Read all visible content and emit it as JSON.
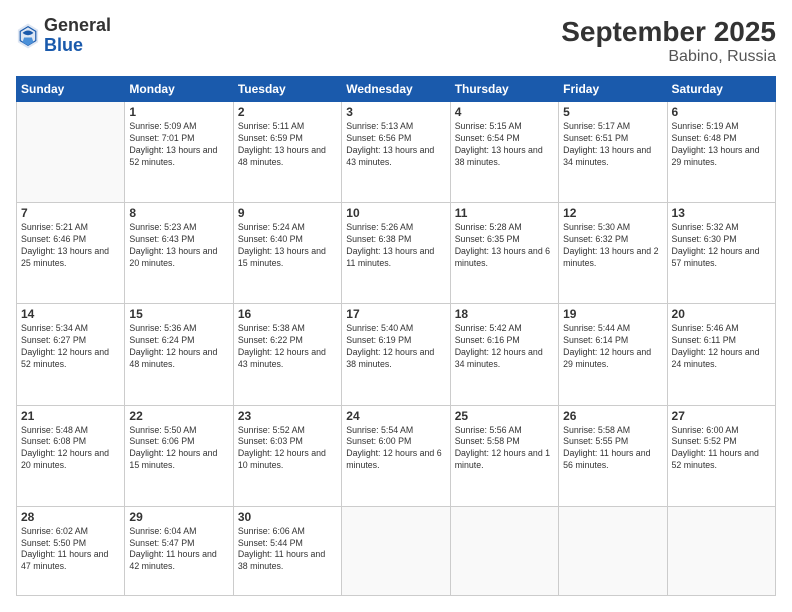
{
  "logo": {
    "general": "General",
    "blue": "Blue"
  },
  "title": {
    "month": "September 2025",
    "location": "Babino, Russia"
  },
  "weekdays": [
    "Sunday",
    "Monday",
    "Tuesday",
    "Wednesday",
    "Thursday",
    "Friday",
    "Saturday"
  ],
  "weeks": [
    [
      {
        "day": "",
        "empty": true
      },
      {
        "day": "1",
        "sunrise": "Sunrise: 5:09 AM",
        "sunset": "Sunset: 7:01 PM",
        "daylight": "Daylight: 13 hours and 52 minutes."
      },
      {
        "day": "2",
        "sunrise": "Sunrise: 5:11 AM",
        "sunset": "Sunset: 6:59 PM",
        "daylight": "Daylight: 13 hours and 48 minutes."
      },
      {
        "day": "3",
        "sunrise": "Sunrise: 5:13 AM",
        "sunset": "Sunset: 6:56 PM",
        "daylight": "Daylight: 13 hours and 43 minutes."
      },
      {
        "day": "4",
        "sunrise": "Sunrise: 5:15 AM",
        "sunset": "Sunset: 6:54 PM",
        "daylight": "Daylight: 13 hours and 38 minutes."
      },
      {
        "day": "5",
        "sunrise": "Sunrise: 5:17 AM",
        "sunset": "Sunset: 6:51 PM",
        "daylight": "Daylight: 13 hours and 34 minutes."
      },
      {
        "day": "6",
        "sunrise": "Sunrise: 5:19 AM",
        "sunset": "Sunset: 6:48 PM",
        "daylight": "Daylight: 13 hours and 29 minutes."
      }
    ],
    [
      {
        "day": "7",
        "sunrise": "Sunrise: 5:21 AM",
        "sunset": "Sunset: 6:46 PM",
        "daylight": "Daylight: 13 hours and 25 minutes."
      },
      {
        "day": "8",
        "sunrise": "Sunrise: 5:23 AM",
        "sunset": "Sunset: 6:43 PM",
        "daylight": "Daylight: 13 hours and 20 minutes."
      },
      {
        "day": "9",
        "sunrise": "Sunrise: 5:24 AM",
        "sunset": "Sunset: 6:40 PM",
        "daylight": "Daylight: 13 hours and 15 minutes."
      },
      {
        "day": "10",
        "sunrise": "Sunrise: 5:26 AM",
        "sunset": "Sunset: 6:38 PM",
        "daylight": "Daylight: 13 hours and 11 minutes."
      },
      {
        "day": "11",
        "sunrise": "Sunrise: 5:28 AM",
        "sunset": "Sunset: 6:35 PM",
        "daylight": "Daylight: 13 hours and 6 minutes."
      },
      {
        "day": "12",
        "sunrise": "Sunrise: 5:30 AM",
        "sunset": "Sunset: 6:32 PM",
        "daylight": "Daylight: 13 hours and 2 minutes."
      },
      {
        "day": "13",
        "sunrise": "Sunrise: 5:32 AM",
        "sunset": "Sunset: 6:30 PM",
        "daylight": "Daylight: 12 hours and 57 minutes."
      }
    ],
    [
      {
        "day": "14",
        "sunrise": "Sunrise: 5:34 AM",
        "sunset": "Sunset: 6:27 PM",
        "daylight": "Daylight: 12 hours and 52 minutes."
      },
      {
        "day": "15",
        "sunrise": "Sunrise: 5:36 AM",
        "sunset": "Sunset: 6:24 PM",
        "daylight": "Daylight: 12 hours and 48 minutes."
      },
      {
        "day": "16",
        "sunrise": "Sunrise: 5:38 AM",
        "sunset": "Sunset: 6:22 PM",
        "daylight": "Daylight: 12 hours and 43 minutes."
      },
      {
        "day": "17",
        "sunrise": "Sunrise: 5:40 AM",
        "sunset": "Sunset: 6:19 PM",
        "daylight": "Daylight: 12 hours and 38 minutes."
      },
      {
        "day": "18",
        "sunrise": "Sunrise: 5:42 AM",
        "sunset": "Sunset: 6:16 PM",
        "daylight": "Daylight: 12 hours and 34 minutes."
      },
      {
        "day": "19",
        "sunrise": "Sunrise: 5:44 AM",
        "sunset": "Sunset: 6:14 PM",
        "daylight": "Daylight: 12 hours and 29 minutes."
      },
      {
        "day": "20",
        "sunrise": "Sunrise: 5:46 AM",
        "sunset": "Sunset: 6:11 PM",
        "daylight": "Daylight: 12 hours and 24 minutes."
      }
    ],
    [
      {
        "day": "21",
        "sunrise": "Sunrise: 5:48 AM",
        "sunset": "Sunset: 6:08 PM",
        "daylight": "Daylight: 12 hours and 20 minutes."
      },
      {
        "day": "22",
        "sunrise": "Sunrise: 5:50 AM",
        "sunset": "Sunset: 6:06 PM",
        "daylight": "Daylight: 12 hours and 15 minutes."
      },
      {
        "day": "23",
        "sunrise": "Sunrise: 5:52 AM",
        "sunset": "Sunset: 6:03 PM",
        "daylight": "Daylight: 12 hours and 10 minutes."
      },
      {
        "day": "24",
        "sunrise": "Sunrise: 5:54 AM",
        "sunset": "Sunset: 6:00 PM",
        "daylight": "Daylight: 12 hours and 6 minutes."
      },
      {
        "day": "25",
        "sunrise": "Sunrise: 5:56 AM",
        "sunset": "Sunset: 5:58 PM",
        "daylight": "Daylight: 12 hours and 1 minute."
      },
      {
        "day": "26",
        "sunrise": "Sunrise: 5:58 AM",
        "sunset": "Sunset: 5:55 PM",
        "daylight": "Daylight: 11 hours and 56 minutes."
      },
      {
        "day": "27",
        "sunrise": "Sunrise: 6:00 AM",
        "sunset": "Sunset: 5:52 PM",
        "daylight": "Daylight: 11 hours and 52 minutes."
      }
    ],
    [
      {
        "day": "28",
        "sunrise": "Sunrise: 6:02 AM",
        "sunset": "Sunset: 5:50 PM",
        "daylight": "Daylight: 11 hours and 47 minutes."
      },
      {
        "day": "29",
        "sunrise": "Sunrise: 6:04 AM",
        "sunset": "Sunset: 5:47 PM",
        "daylight": "Daylight: 11 hours and 42 minutes."
      },
      {
        "day": "30",
        "sunrise": "Sunrise: 6:06 AM",
        "sunset": "Sunset: 5:44 PM",
        "daylight": "Daylight: 11 hours and 38 minutes."
      },
      {
        "day": "",
        "empty": true
      },
      {
        "day": "",
        "empty": true
      },
      {
        "day": "",
        "empty": true
      },
      {
        "day": "",
        "empty": true
      }
    ]
  ]
}
